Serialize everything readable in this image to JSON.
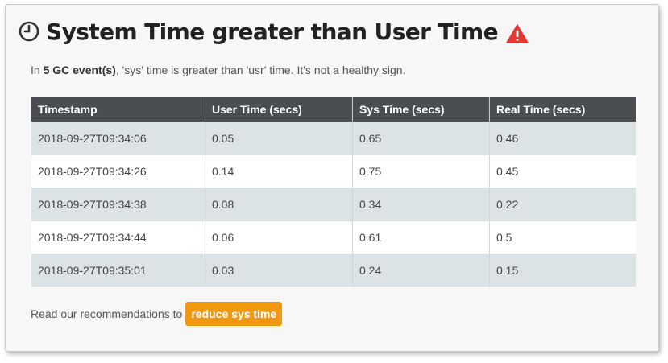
{
  "header": {
    "title": "System Time greater than User Time",
    "clock_icon": "clock-icon",
    "warning_icon": "warning-icon",
    "warning_color": "#e53935"
  },
  "description": {
    "prefix": "In ",
    "highlight": "5 GC event(s)",
    "suffix": ", 'sys' time is greater than 'usr' time. It's not a healthy sign."
  },
  "table": {
    "columns": [
      "Timestamp",
      "User Time (secs)",
      "Sys Time (secs)",
      "Real Time (secs)"
    ],
    "rows": [
      [
        "2018-09-27T09:34:06",
        "0.05",
        "0.65",
        "0.46"
      ],
      [
        "2018-09-27T09:34:26",
        "0.14",
        "0.75",
        "0.45"
      ],
      [
        "2018-09-27T09:34:38",
        "0.08",
        "0.34",
        "0.22"
      ],
      [
        "2018-09-27T09:34:44",
        "0.06",
        "0.61",
        "0.5"
      ],
      [
        "2018-09-27T09:35:01",
        "0.03",
        "0.24",
        "0.15"
      ]
    ]
  },
  "recommendation": {
    "text": "Read our recommendations to",
    "button_label": "reduce sys time",
    "button_color": "#f0980f"
  }
}
